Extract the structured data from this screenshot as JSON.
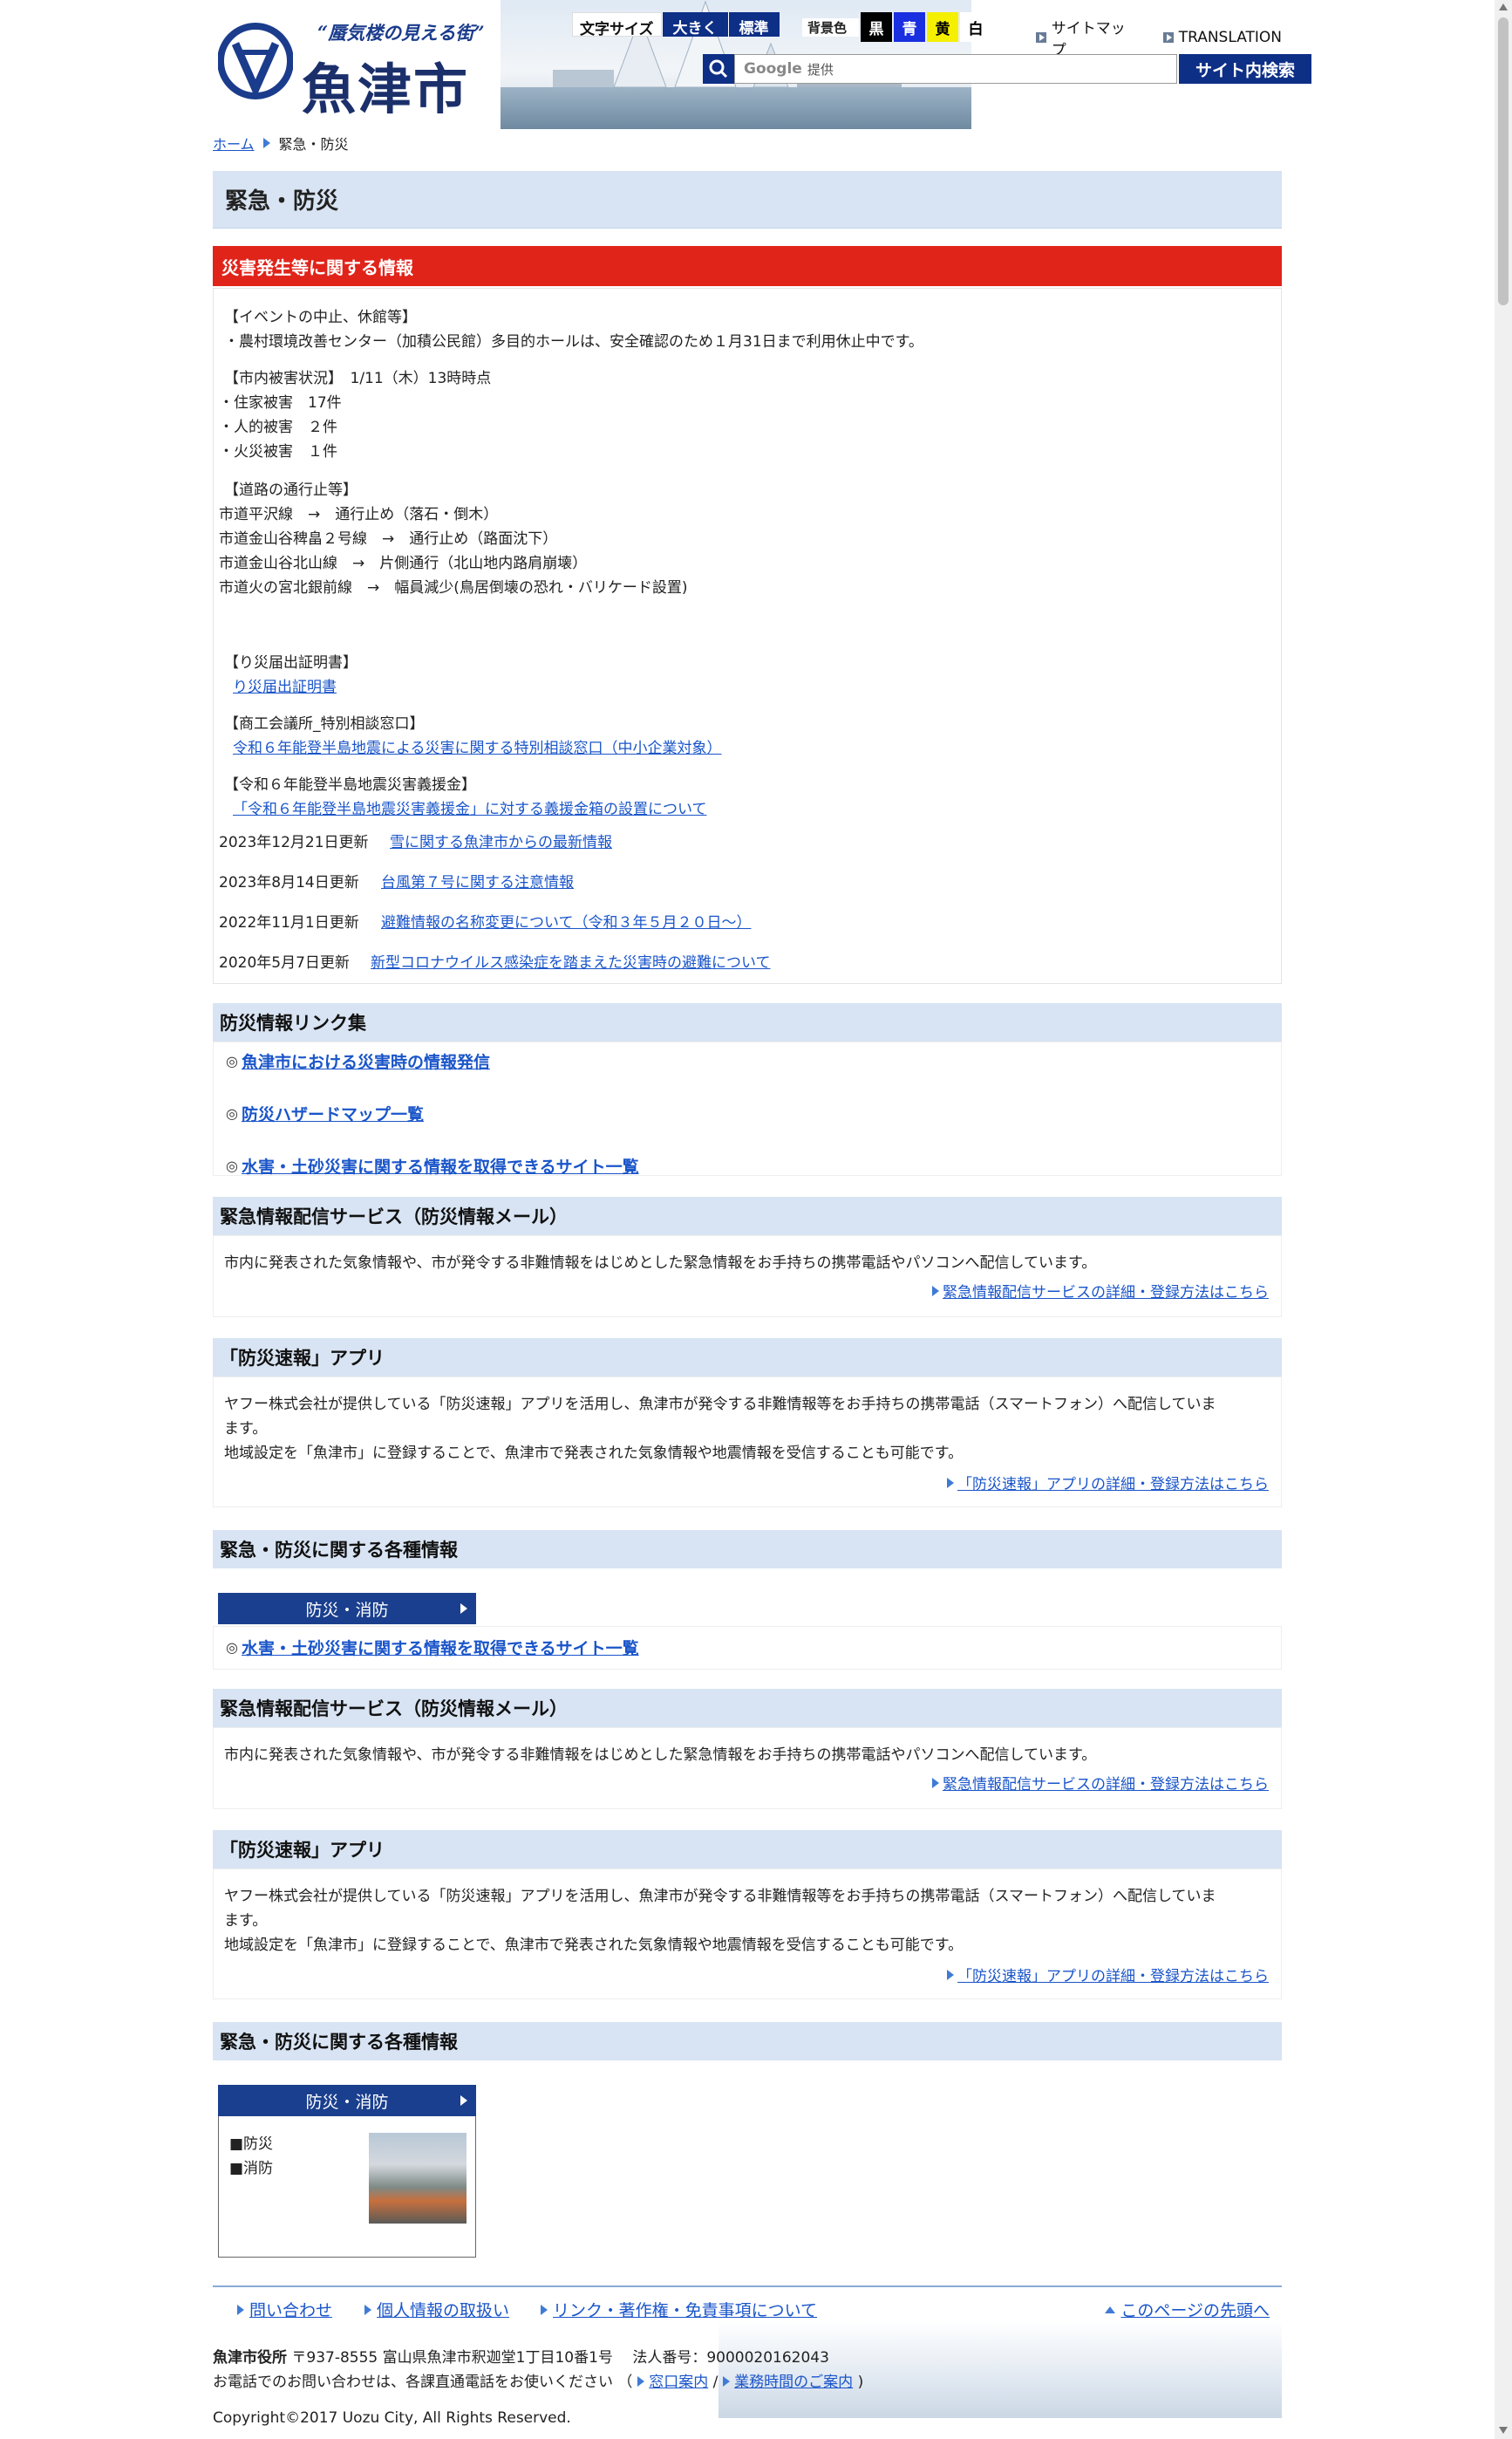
{
  "header": {
    "slogan": "“蜃気楼の見える街”",
    "city_name": "魚津市",
    "font_size_label": "文字サイズ",
    "font_size_large": "大きく",
    "font_size_standard": "標準",
    "bg_color_label": "背景色",
    "bg_black": "黒",
    "bg_blue": "青",
    "bg_yellow": "黄",
    "bg_white": "白",
    "sitemap": "サイトマップ",
    "translation": "TRANSLATION",
    "search_google": "Google",
    "search_provided": "提供",
    "search_button": "サイト内検索"
  },
  "breadcrumb": {
    "home": "ホーム",
    "current": "緊急・防災"
  },
  "page_title": "緊急・防災",
  "disaster": {
    "heading": "災害発生等に関する情報",
    "event_head": "【イベントの中止、休館等】",
    "event_1": "・農村環境改善センター（加積公民館）多目的ホールは、安全確認のため１月31日まで利用休止中です。",
    "damage_head": "【市内被害状況】　1/11（木）13時時点",
    "damage_1": "・住家被害　17件",
    "damage_2": "・人的被害　２件",
    "damage_3": "・火災被害　１件",
    "road_head": "【道路の通行止等】",
    "road_1": "市道平沢線　→　通行止め（落石・倒木）",
    "road_2": "市道金山谷稗畠２号線　→　通行止め（路面沈下）",
    "road_3": "市道金山谷北山線　→　片側通行（北山地内路肩崩壊）",
    "road_4": "市道火の宮北銀前線　→　幅員減少(鳥居倒壊の恐れ・バリケード設置)",
    "cert_head": "【り災届出証明書】",
    "cert_link": "り災届出証明書",
    "chamber_head": "【商工会議所_特別相談窓口】",
    "chamber_link": "令和６年能登半島地震による災害に関する特別相談窓口（中小企業対象）",
    "donation_head": "【令和６年能登半島地震災害義援金】",
    "donation_link": "「令和６年能登半島地震災害義援金」に対する義援金箱の設置について",
    "updates": [
      {
        "date": "2023年12月21日更新",
        "link": "雪に関する魚津市からの最新情報"
      },
      {
        "date": "2023年8月14日更新",
        "link": "台風第７号に関する注意情報"
      },
      {
        "date": "2022年11月1日更新",
        "link": "避難情報の名称変更について（令和３年５月２０日～）"
      },
      {
        "date": "2020年5月7日更新",
        "link": "新型コロナウイルス感染症を踏まえた災害時の避難について"
      }
    ]
  },
  "bousai_links": {
    "heading": "防災情報リンク集",
    "marker": "◎",
    "items": [
      "魚津市における災害時の情報発信",
      "防災ハザードマップ一覧",
      "水害・土砂災害に関する情報を取得できるサイト一覧"
    ]
  },
  "mail_service": {
    "heading": "緊急情報配信サービス（防災情報メール）",
    "text": "市内に発表された気象情報や、市が発令する非難情報をはじめとした緊急情報をお手持ちの携帯電話やパソコンへ配信しています。",
    "link": "緊急情報配信サービスの詳細・登録方法はこちら"
  },
  "app": {
    "heading": "「防災速報」アプリ",
    "text_1": "ヤフー株式会社が提供している「防災速報」アプリを活用し、魚津市が発令する非難情報等をお手持ちの携帯電話（スマートフォン）へ配信していま",
    "text_1b": "ます。",
    "text_2": "地域設定を「魚津市」に登録することで、魚津市で発表された気象情報や地震情報を受信することも可能です。",
    "link": "「防災速報」アプリの詳細・登録方法はこちら"
  },
  "various": {
    "heading": "緊急・防災に関する各種情報",
    "nav_label": "防災・消防",
    "link": "水害・土砂災害に関する情報を取得できるサイト一覧",
    "cat_items": [
      "■防災",
      "■消防"
    ]
  },
  "footer": {
    "inquiry": "問い合わせ",
    "privacy": "個人情報の取扱い",
    "links": "リンク・著作権・免責事項について",
    "page_top": "このページの先頭へ",
    "office": "魚津市役所",
    "address": "〒937-8555 富山県魚津市釈迦堂1丁目10番1号　 法人番号：9000020162043",
    "phone_note": "お電話でのお問い合わせは、各課直通電話をお使いください （",
    "counter": "窓口案内",
    "sep": "/",
    "hours": "業務時間のご案内",
    "close": ")",
    "copyright": "Copyright©2017 Uozu City, All Rights Reserved."
  },
  "colors": {
    "accent_navy": "#0e2f86",
    "disaster_red": "#e0241a",
    "section_bg": "#d8e4f3",
    "link": "#1a55c9"
  }
}
